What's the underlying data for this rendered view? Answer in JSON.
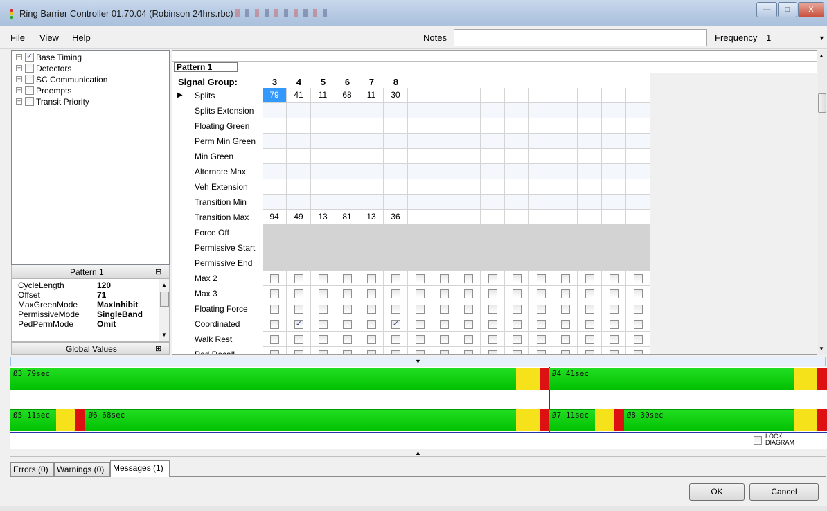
{
  "window": {
    "title": "Ring Barrier Controller 01.70.04 (Robinson 24hrs.rbc)",
    "controls": {
      "minimize": "—",
      "maximize": "□",
      "close": "X"
    }
  },
  "menu": {
    "file": "File",
    "view": "View",
    "help": "Help",
    "notes_label": "Notes",
    "notes_value": "",
    "frequency_label": "Frequency",
    "frequency_value": "1"
  },
  "tree": {
    "items": [
      {
        "label": "Base Timing",
        "checked": true
      },
      {
        "label": "Detectors",
        "checked": false
      },
      {
        "label": "SC Communication",
        "checked": false
      },
      {
        "label": "Preempts",
        "checked": false
      },
      {
        "label": "Transit Priority",
        "checked": false
      }
    ]
  },
  "properties": {
    "header": "Pattern 1",
    "rows": [
      {
        "key": "CycleLength",
        "value": "120"
      },
      {
        "key": "Offset",
        "value": "71"
      },
      {
        "key": "MaxGreenMode",
        "value": "MaxInhibit"
      },
      {
        "key": "PermissiveMode",
        "value": "SingleBand"
      },
      {
        "key": "PedPermMode",
        "value": "Omit"
      }
    ],
    "global_header": "Global Values"
  },
  "grid": {
    "pattern_tab": "Pattern 1",
    "signal_group_label": "Signal Group:",
    "signal_groups": [
      "3",
      "4",
      "5",
      "6",
      "7",
      "8"
    ],
    "rows": [
      {
        "label": "Splits",
        "values": [
          "79",
          "41",
          "11",
          "68",
          "11",
          "30"
        ]
      },
      {
        "label": "Splits Extension"
      },
      {
        "label": "Floating Green"
      },
      {
        "label": "Perm Min Green"
      },
      {
        "label": "Min Green"
      },
      {
        "label": "Alternate Max"
      },
      {
        "label": "Veh Extension"
      },
      {
        "label": "Transition Min"
      },
      {
        "label": "Transition Max",
        "values": [
          "94",
          "49",
          "13",
          "81",
          "13",
          "36"
        ]
      },
      {
        "label": "Force Off"
      },
      {
        "label": "Permissive Start"
      },
      {
        "label": "Permissive End"
      },
      {
        "label": "Max 2"
      },
      {
        "label": "Max 3"
      },
      {
        "label": "Floating Force"
      },
      {
        "label": "Coordinated",
        "checked_columns": [
          1,
          5
        ]
      },
      {
        "label": "Walk Rest"
      },
      {
        "label": "Ped Recall"
      }
    ]
  },
  "diagram": {
    "ring1": [
      {
        "label": "Ø3 79sec",
        "seconds": 79
      },
      {
        "label": "Ø4 41sec",
        "seconds": 41
      }
    ],
    "ring2": [
      {
        "label": "Ø5 11sec",
        "seconds": 11
      },
      {
        "label": "Ø6 68sec",
        "seconds": 68
      },
      {
        "label": "Ø7 11sec",
        "seconds": 11
      },
      {
        "label": "Ø8 30sec",
        "seconds": 30
      }
    ],
    "lock_label": "LOCK Diagram"
  },
  "tabs": [
    "Errors (0)",
    "Warnings (0)",
    "Messages (1)"
  ],
  "buttons": {
    "ok": "OK",
    "cancel": "Cancel"
  },
  "colors": {
    "green": "#00c000",
    "yellow": "#f6e21a",
    "red": "#dd1111",
    "selection": "#3399ff"
  }
}
